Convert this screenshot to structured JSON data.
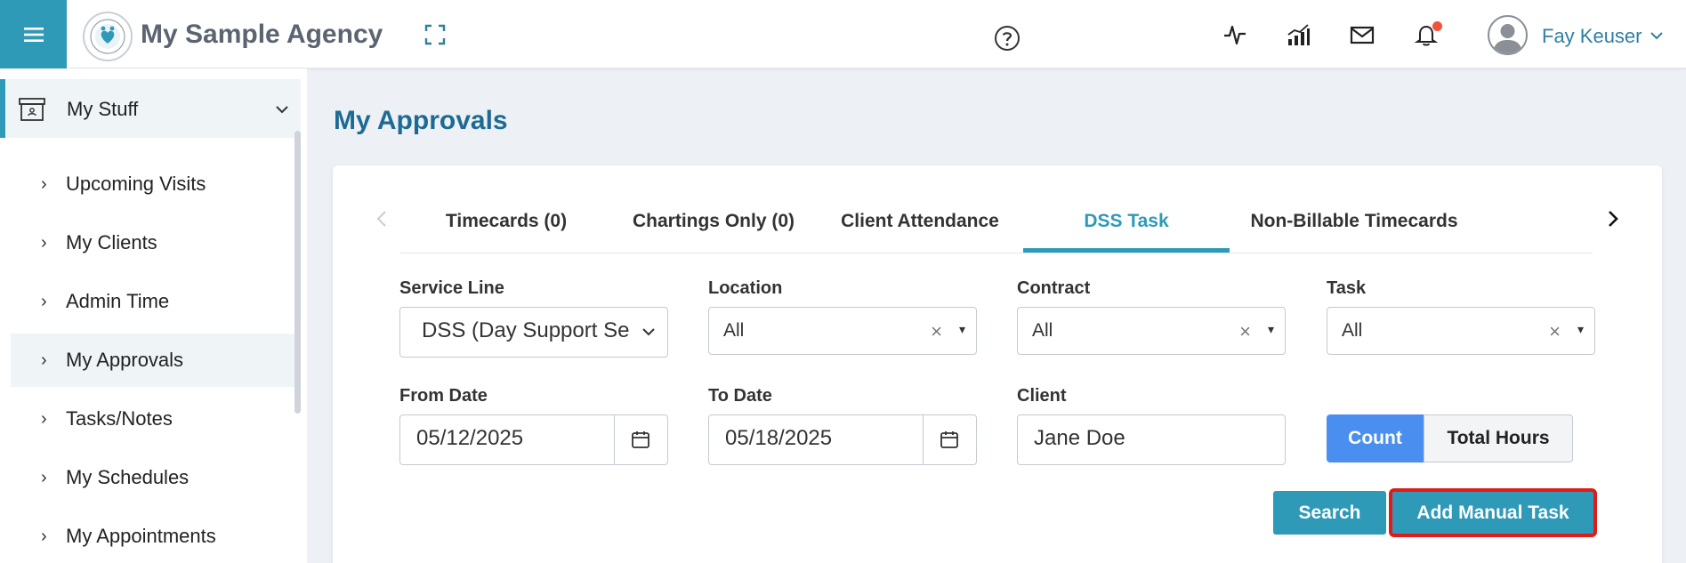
{
  "header": {
    "brand": "My Sample Agency",
    "username": "Fay Keuser",
    "icons": [
      "menu-icon",
      "logo",
      "expand-icon",
      "help-icon",
      "activity-icon",
      "chart-icon",
      "mail-icon",
      "bell-icon",
      "avatar-icon",
      "chevron-down-icon"
    ],
    "accent_color": "#2f9ab8",
    "notification_color": "#f0533a"
  },
  "sidebar": {
    "section_label": "My Stuff",
    "items": [
      {
        "label": "Upcoming Visits"
      },
      {
        "label": "My Clients"
      },
      {
        "label": "Admin Time"
      },
      {
        "label": "My Approvals",
        "active": true
      },
      {
        "label": "Tasks/Notes"
      },
      {
        "label": "My Schedules"
      },
      {
        "label": "My Appointments"
      }
    ]
  },
  "main": {
    "title": "My Approvals",
    "tabs": [
      {
        "label": "Timecards (0)"
      },
      {
        "label": "Chartings Only (0)"
      },
      {
        "label": "Client Attendance"
      },
      {
        "label": "DSS Task",
        "active": true
      },
      {
        "label": "Non-Billable Timecards"
      }
    ],
    "filters": {
      "service_line": {
        "label": "Service Line",
        "value": "DSS (Day Support Ser"
      },
      "location": {
        "label": "Location",
        "value": "All"
      },
      "contract": {
        "label": "Contract",
        "value": "All"
      },
      "task": {
        "label": "Task",
        "value": "All"
      },
      "from_date": {
        "label": "From Date",
        "value": "05/12/2025"
      },
      "to_date": {
        "label": "To Date",
        "value": "05/18/2025"
      },
      "client": {
        "label": "Client",
        "value": "Jane Doe"
      }
    },
    "toggle": {
      "count": "Count",
      "total_hours": "Total Hours",
      "selected": "Count"
    },
    "buttons": {
      "search": "Search",
      "add_manual_task": "Add Manual Task"
    },
    "clear_glyph": "×",
    "caret_glyph": "▾"
  }
}
